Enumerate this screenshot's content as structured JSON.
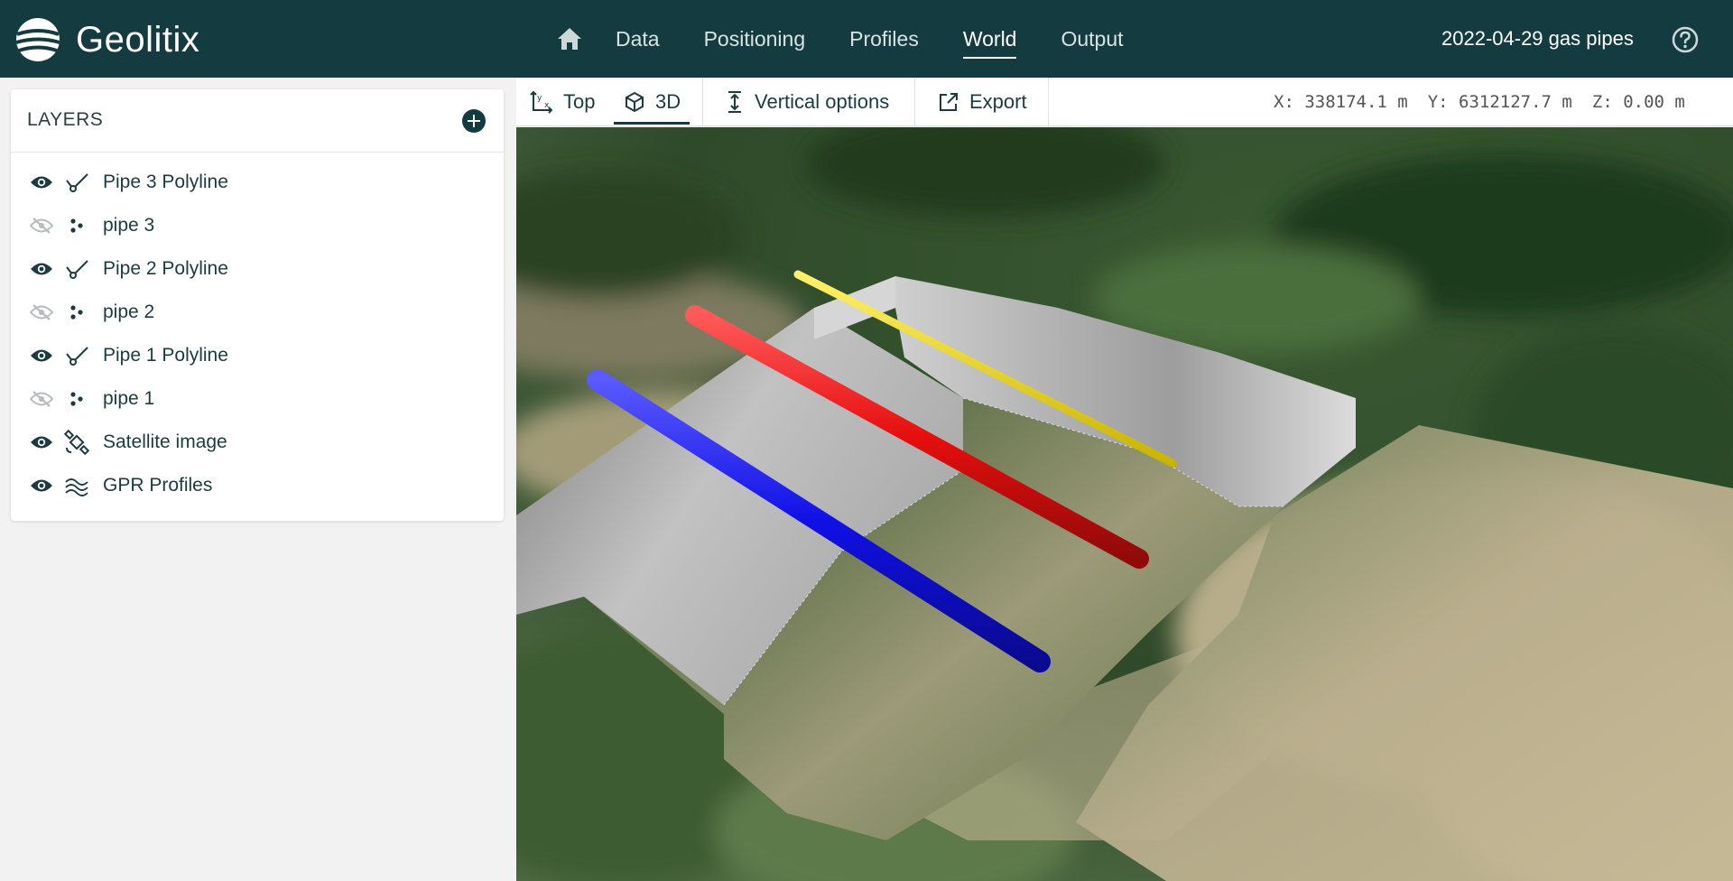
{
  "header": {
    "logo_text": "Geolitix",
    "nav": [
      {
        "label": "Data",
        "active": false
      },
      {
        "label": "Positioning",
        "active": false
      },
      {
        "label": "Profiles",
        "active": false
      },
      {
        "label": "World",
        "active": true
      },
      {
        "label": "Output",
        "active": false
      }
    ],
    "project_title": "2022-04-29 gas pipes"
  },
  "layers": {
    "title": "LAYERS",
    "items": [
      {
        "label": "Pipe 3 Polyline",
        "visible": true,
        "type_icon": "polyline-icon"
      },
      {
        "label": "pipe 3",
        "visible": false,
        "type_icon": "points-icon"
      },
      {
        "label": "Pipe 2 Polyline",
        "visible": true,
        "type_icon": "polyline-icon"
      },
      {
        "label": "pipe 2",
        "visible": false,
        "type_icon": "points-icon"
      },
      {
        "label": "Pipe 1 Polyline",
        "visible": true,
        "type_icon": "polyline-icon"
      },
      {
        "label": "pipe 1",
        "visible": false,
        "type_icon": "points-icon"
      },
      {
        "label": "Satellite image",
        "visible": true,
        "type_icon": "satellite-icon"
      },
      {
        "label": "GPR Profiles",
        "visible": true,
        "type_icon": "profiles-icon"
      }
    ]
  },
  "toolbar": {
    "top_label": "Top",
    "view3d_label": "3D",
    "vertical_label": "Vertical options",
    "export_label": "Export",
    "active_view": "3D"
  },
  "coords": {
    "x": "X: 338174.1 m",
    "y": "Y: 6312127.7 m",
    "z": "Z: 0.00 m"
  },
  "scene": {
    "pipe_colors": {
      "pipe1": "#1010e6",
      "pipe2": "#e60e0e",
      "pipe3": "#f0e010"
    }
  }
}
